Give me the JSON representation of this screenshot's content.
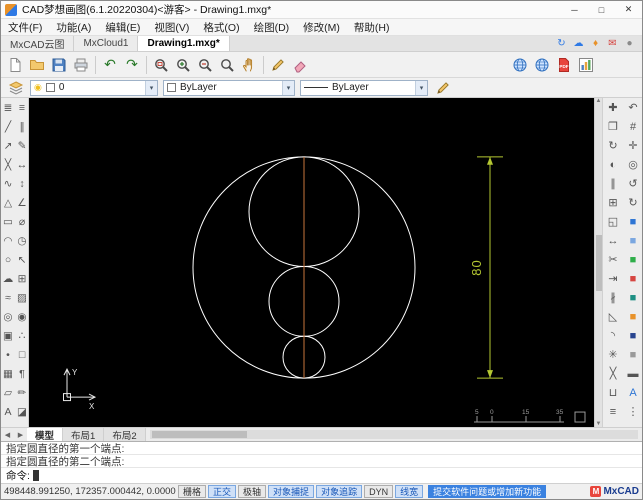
{
  "palette": {
    "canvas_bg": "#000000",
    "entity": "#ffffff",
    "axis": "#c8763c",
    "dimension": "#b5c832",
    "accent": "#1857b8"
  },
  "titlebar": {
    "title": "CAD梦想画图(6.1.20220304)<游客> -  Drawing1.mxg*",
    "min": "─",
    "max": "□",
    "close": "✕"
  },
  "menubar": {
    "items": [
      {
        "name": "menu-file",
        "label": "文件(F)"
      },
      {
        "name": "menu-function",
        "label": "功能(A)"
      },
      {
        "name": "menu-edit",
        "label": "编辑(E)"
      },
      {
        "name": "menu-view",
        "label": "视图(V)"
      },
      {
        "name": "menu-format",
        "label": "格式(O)"
      },
      {
        "name": "menu-draw",
        "label": "绘图(D)"
      },
      {
        "name": "menu-modify",
        "label": "修改(M)"
      },
      {
        "name": "menu-help",
        "label": "帮助(H)"
      }
    ]
  },
  "tabbar": {
    "tabs": [
      {
        "name": "tab-mxcad-cloud",
        "label": "MxCAD云图"
      },
      {
        "name": "tab-mxcloud1",
        "label": "MxCloud1"
      },
      {
        "name": "tab-drawing1",
        "label": "Drawing1.mxg*",
        "active": true
      }
    ],
    "right_icons": [
      {
        "name": "refresh-icon",
        "glyph": "↻",
        "color": "#2f7ae5"
      },
      {
        "name": "cloud-icon",
        "glyph": "☁",
        "color": "#2f7ae5"
      },
      {
        "name": "vip-icon",
        "glyph": "♦",
        "color": "#e8922a"
      },
      {
        "name": "mail-icon",
        "glyph": "✉",
        "color": "#d64541"
      },
      {
        "name": "user-icon",
        "glyph": "●",
        "color": "#8a8a8a"
      }
    ]
  },
  "toolbar1": {
    "left": [
      {
        "name": "new-file-button",
        "icon": "page"
      },
      {
        "name": "open-file-button",
        "icon": "folder"
      },
      {
        "name": "save-button",
        "icon": "floppy"
      },
      {
        "name": "plot-button",
        "icon": "printer"
      },
      {
        "sep": true
      },
      {
        "name": "undo-button",
        "glyph": "↶",
        "color": "#2a7a2a"
      },
      {
        "name": "redo-button",
        "glyph": "↷",
        "color": "#2a7a2a"
      },
      {
        "sep": true
      },
      {
        "name": "zoom-window-button",
        "icon": "magw"
      },
      {
        "name": "zoom-in-button",
        "icon": "magp"
      },
      {
        "name": "zoom-out-button",
        "icon": "magm"
      },
      {
        "name": "zoom-extents-button",
        "icon": "mag"
      },
      {
        "name": "pan-button",
        "icon": "hand"
      },
      {
        "sep": true
      },
      {
        "name": "draw-pencil-button",
        "icon": "pencil"
      },
      {
        "name": "erase-button",
        "icon": "eraser"
      }
    ],
    "right": [
      {
        "name": "mxcad-web-button",
        "icon": "globe"
      },
      {
        "name": "cloud-share-button",
        "icon": "globe"
      },
      {
        "name": "pdf-export-button",
        "icon": "pdf"
      },
      {
        "name": "report-button",
        "icon": "chart"
      }
    ]
  },
  "toolbar2": {
    "caret": "▾",
    "layer": {
      "value": "0"
    },
    "color": {
      "value": "ByLayer"
    },
    "linetype": {
      "value": "ByLayer"
    }
  },
  "panels": {
    "left": [
      {
        "name": "draw-menu-icon",
        "glyph": "≣"
      },
      {
        "name": "line-icon",
        "glyph": "╱"
      },
      {
        "name": "ray-icon",
        "glyph": "↗"
      },
      {
        "name": "construction-line-icon",
        "glyph": "╳"
      },
      {
        "name": "polyline-icon",
        "glyph": "∿"
      },
      {
        "name": "polygon-icon",
        "glyph": "△"
      },
      {
        "name": "rectangle-icon",
        "glyph": "▭"
      },
      {
        "name": "arc-icon",
        "glyph": "◠"
      },
      {
        "name": "circle-icon",
        "glyph": "○"
      },
      {
        "name": "revision-cloud-icon",
        "glyph": "☁"
      },
      {
        "name": "spline-icon",
        "glyph": "≈"
      },
      {
        "name": "ellipse-icon",
        "glyph": "◎"
      },
      {
        "name": "block-icon",
        "glyph": "▣"
      },
      {
        "name": "point-icon",
        "glyph": "•"
      },
      {
        "name": "hatch-icon",
        "glyph": "▦"
      },
      {
        "name": "region-icon",
        "glyph": "▱"
      },
      {
        "name": "text-icon",
        "glyph": "A"
      },
      {
        "name": "tools-menu-icon",
        "glyph": "≡"
      },
      {
        "name": "multiline-icon",
        "glyph": "∥"
      },
      {
        "name": "edit-polyline-icon",
        "glyph": "✎"
      },
      {
        "name": "dim-linear-icon",
        "glyph": "↔"
      },
      {
        "name": "dim-vertical-icon",
        "glyph": "↕"
      },
      {
        "name": "dim-angular-icon",
        "glyph": "∠"
      },
      {
        "name": "dim-diameter-icon",
        "glyph": "⌀"
      },
      {
        "name": "dim-radius-icon",
        "glyph": "◷"
      },
      {
        "name": "leader-icon",
        "glyph": "↖"
      },
      {
        "name": "table-icon",
        "glyph": "⊞"
      },
      {
        "name": "wipeout-icon",
        "glyph": "▨"
      },
      {
        "name": "donut-icon",
        "glyph": "◉"
      },
      {
        "name": "divide-icon",
        "glyph": "∴"
      },
      {
        "name": "boundary-icon",
        "glyph": "□"
      },
      {
        "name": "mtext-icon",
        "glyph": "¶"
      },
      {
        "name": "sketch-icon",
        "glyph": "✏"
      },
      {
        "name": "eraser-tool-icon",
        "glyph": "◪"
      }
    ],
    "right": [
      {
        "name": "move-icon",
        "glyph": "✚"
      },
      {
        "name": "copy-icon",
        "glyph": "❐"
      },
      {
        "name": "rotate-icon",
        "glyph": "↻"
      },
      {
        "name": "mirror-icon",
        "glyph": "◐"
      },
      {
        "name": "offset-icon",
        "glyph": "∥"
      },
      {
        "name": "array-icon",
        "glyph": "⊞"
      },
      {
        "name": "scale-icon",
        "glyph": "◱"
      },
      {
        "name": "stretch-icon",
        "glyph": "↔"
      },
      {
        "name": "trim-icon",
        "glyph": "✂"
      },
      {
        "name": "extend-icon",
        "glyph": "⇥"
      },
      {
        "name": "break-icon",
        "glyph": "∦"
      },
      {
        "name": "chamfer-icon",
        "glyph": "◺"
      },
      {
        "name": "fillet-icon",
        "glyph": "◝"
      },
      {
        "name": "explode-icon",
        "glyph": "✳"
      },
      {
        "name": "erase-modify-icon",
        "glyph": "╳"
      },
      {
        "name": "join-icon",
        "glyph": "⊔"
      },
      {
        "name": "properties-icon",
        "glyph": "≡"
      },
      {
        "name": "zoom-previous-icon",
        "glyph": "↶"
      },
      {
        "name": "named-views-icon",
        "glyph": "#"
      },
      {
        "name": "pan-tool-icon",
        "glyph": "✛"
      },
      {
        "name": "orbit-icon",
        "glyph": "◎"
      },
      {
        "name": "regen-icon",
        "glyph": "↺"
      },
      {
        "name": "redraw-icon",
        "glyph": "↻"
      },
      {
        "name": "draworder-front-icon",
        "glyph": "■",
        "color": "#2e75d4"
      },
      {
        "name": "draworder-back-icon",
        "glyph": "■",
        "color": "#7ba7e0"
      },
      {
        "name": "layer-on-icon",
        "glyph": "■",
        "color": "#2fae4a"
      },
      {
        "name": "layer-off-icon",
        "glyph": "■",
        "color": "#d64541"
      },
      {
        "name": "layer-freeze-icon",
        "glyph": "■",
        "color": "#1d8f83"
      },
      {
        "name": "layer-lock-icon",
        "glyph": "■",
        "color": "#e8922a"
      },
      {
        "name": "color-picker-icon",
        "glyph": "■",
        "color": "#27448f"
      },
      {
        "name": "linetype-tool-icon",
        "glyph": "■",
        "color": "#9a9a9a"
      },
      {
        "name": "lineweight-icon",
        "glyph": "▬"
      },
      {
        "name": "text-style-icon",
        "glyph": "A",
        "color": "#2e75d4"
      },
      {
        "name": "more-icon",
        "glyph": "⋮"
      }
    ]
  },
  "canvas": {
    "dimension_label": "80",
    "scale_labels": [
      "5",
      "0",
      "15",
      "35"
    ],
    "ucs": {
      "x_label": "X",
      "y_label": "Y"
    }
  },
  "layout_tabs": {
    "prev": "◀",
    "next": "▶",
    "tabs": [
      {
        "name": "layout-tab-model",
        "label": "模型",
        "active": true
      },
      {
        "name": "layout-tab-layout1",
        "label": "布局1"
      },
      {
        "name": "layout-tab-layout2",
        "label": "布局2"
      }
    ]
  },
  "command": {
    "history": [
      "指定圆直径的第一个端点:",
      "指定圆直径的第二个端点:"
    ],
    "prompt": "命令:"
  },
  "statusbar": {
    "coords": "498448.991250,  172357.000442,  0.000000",
    "toggles": [
      {
        "name": "toggle-grid",
        "label": "栅格",
        "on": false
      },
      {
        "name": "toggle-ortho",
        "label": "正交",
        "on": true
      },
      {
        "name": "toggle-polar",
        "label": "极轴",
        "on": false
      },
      {
        "name": "toggle-osnap",
        "label": "对象捕捉",
        "on": true
      },
      {
        "name": "toggle-otrack",
        "label": "对象追踪",
        "on": true
      },
      {
        "name": "toggle-dyn",
        "label": "DYN",
        "on": false
      },
      {
        "name": "toggle-lineweight",
        "label": "线宽",
        "on": true
      }
    ],
    "feedback_link": "提交软件问题或增加新功能",
    "brand": "MxCAD"
  }
}
